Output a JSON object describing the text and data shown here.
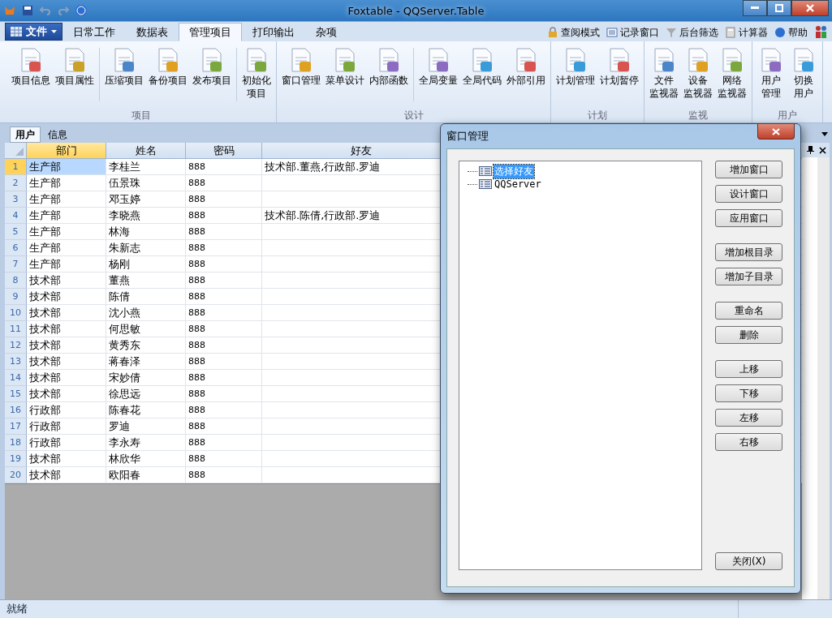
{
  "window": {
    "title": "Foxtable - QQServer.Table"
  },
  "ribbon_tabs": [
    {
      "label": "日常工作",
      "selected": false
    },
    {
      "label": "数据表",
      "selected": false
    },
    {
      "label": "管理项目",
      "selected": true
    },
    {
      "label": "打印输出",
      "selected": false
    },
    {
      "label": "杂项",
      "selected": false
    }
  ],
  "file_menu": {
    "label": "文件"
  },
  "quick_tools": [
    {
      "label": "查阅模式"
    },
    {
      "label": "记录窗口"
    },
    {
      "label": "后台筛选"
    },
    {
      "label": "计算器"
    },
    {
      "label": "帮助"
    }
  ],
  "ribbon_groups": [
    {
      "title": "项目",
      "sections": [
        [
          [
            "项目信息"
          ],
          [
            "项目属性"
          ]
        ],
        [
          [
            "压缩项目"
          ],
          [
            "备份项目"
          ],
          [
            "发布项目"
          ]
        ],
        [
          [
            "初始化",
            "项目"
          ]
        ]
      ]
    },
    {
      "title": "设计",
      "sections": [
        [
          [
            "窗口管理"
          ],
          [
            "菜单设计"
          ],
          [
            "内部函数"
          ]
        ],
        [
          [
            "全局变量"
          ],
          [
            "全局代码"
          ],
          [
            "外部引用"
          ]
        ]
      ]
    },
    {
      "title": "计划",
      "sections": [
        [
          [
            "计划管理"
          ],
          [
            "计划暂停"
          ]
        ]
      ]
    },
    {
      "title": "监视",
      "sections": [
        [
          [
            "文件",
            "监视器"
          ],
          [
            "设备",
            "监视器"
          ],
          [
            "网络",
            "监视器"
          ]
        ]
      ]
    },
    {
      "title": "用户",
      "sections": [
        [
          [
            "用户",
            "管理"
          ],
          [
            "切换",
            "用户"
          ]
        ]
      ]
    }
  ],
  "doc_tabs": [
    {
      "label": "用户",
      "selected": true
    },
    {
      "label": "信息",
      "selected": false
    }
  ],
  "table": {
    "columns": [
      {
        "label": "部门",
        "selected": true
      },
      {
        "label": "姓名",
        "selected": false
      },
      {
        "label": "密码",
        "selected": false
      },
      {
        "label": "好友",
        "selected": false
      }
    ],
    "rows": [
      {
        "n": "1",
        "cells": [
          "生产部",
          "李桂兰",
          "888",
          "技术部.董燕,行政部.罗迪"
        ],
        "selected": true
      },
      {
        "n": "2",
        "cells": [
          "生产部",
          "伍景珠",
          "888",
          ""
        ],
        "selected": false
      },
      {
        "n": "3",
        "cells": [
          "生产部",
          "邓玉婷",
          "888",
          ""
        ],
        "selected": false
      },
      {
        "n": "4",
        "cells": [
          "生产部",
          "李晓燕",
          "888",
          "技术部.陈倩,行政部.罗迪"
        ],
        "selected": false
      },
      {
        "n": "5",
        "cells": [
          "生产部",
          "林海",
          "888",
          ""
        ],
        "selected": false
      },
      {
        "n": "6",
        "cells": [
          "生产部",
          "朱新志",
          "888",
          ""
        ],
        "selected": false
      },
      {
        "n": "7",
        "cells": [
          "生产部",
          "杨刚",
          "888",
          ""
        ],
        "selected": false
      },
      {
        "n": "8",
        "cells": [
          "技术部",
          "董燕",
          "888",
          ""
        ],
        "selected": false
      },
      {
        "n": "9",
        "cells": [
          "技术部",
          "陈倩",
          "888",
          ""
        ],
        "selected": false
      },
      {
        "n": "10",
        "cells": [
          "技术部",
          "沈小燕",
          "888",
          ""
        ],
        "selected": false
      },
      {
        "n": "11",
        "cells": [
          "技术部",
          "何思敏",
          "888",
          ""
        ],
        "selected": false
      },
      {
        "n": "12",
        "cells": [
          "技术部",
          "黄秀东",
          "888",
          ""
        ],
        "selected": false
      },
      {
        "n": "13",
        "cells": [
          "技术部",
          "蒋春泽",
          "888",
          ""
        ],
        "selected": false
      },
      {
        "n": "14",
        "cells": [
          "技术部",
          "宋妙倩",
          "888",
          ""
        ],
        "selected": false
      },
      {
        "n": "15",
        "cells": [
          "技术部",
          "徐思远",
          "888",
          ""
        ],
        "selected": false
      },
      {
        "n": "16",
        "cells": [
          "行政部",
          "陈春花",
          "888",
          ""
        ],
        "selected": false
      },
      {
        "n": "17",
        "cells": [
          "行政部",
          "罗迪",
          "888",
          ""
        ],
        "selected": false
      },
      {
        "n": "18",
        "cells": [
          "行政部",
          "李永寿",
          "888",
          ""
        ],
        "selected": false
      },
      {
        "n": "19",
        "cells": [
          "技术部",
          "林欣华",
          "888",
          ""
        ],
        "selected": false
      },
      {
        "n": "20",
        "cells": [
          "技术部",
          "欧阳春",
          "888",
          ""
        ],
        "selected": false
      }
    ]
  },
  "dialog": {
    "title": "窗口管理",
    "tree": [
      {
        "label": "选择好友",
        "selected": true
      },
      {
        "label": "QQServer",
        "selected": false
      }
    ],
    "button_groups": [
      [
        "增加窗口",
        "设计窗口",
        "应用窗口"
      ],
      [
        "增加根目录",
        "增加子目录"
      ],
      [
        "重命名",
        "删除"
      ],
      [
        "上移",
        "下移",
        "左移",
        "右移"
      ]
    ],
    "close_button": "关闭(X)"
  },
  "status_bar": {
    "text": "就绪"
  }
}
